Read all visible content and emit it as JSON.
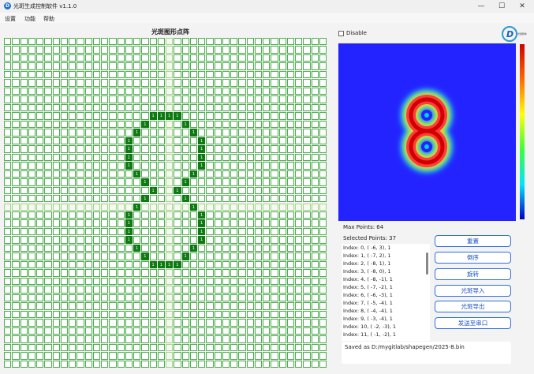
{
  "window": {
    "title": "光斑生成控制软件 v1.1.0",
    "minimize_glyph": "—",
    "maximize_glyph": "☐",
    "close_glyph": "✕"
  },
  "menu": [
    "设置",
    "功能",
    "帮助"
  ],
  "grid": {
    "title": "光斑图形点阵",
    "rows": 40,
    "cols": 40,
    "on_label": "1",
    "on_cells": [
      [
        9,
        18
      ],
      [
        9,
        19
      ],
      [
        9,
        20
      ],
      [
        9,
        21
      ],
      [
        10,
        17
      ],
      [
        10,
        22
      ],
      [
        11,
        16
      ],
      [
        11,
        23
      ],
      [
        12,
        15
      ],
      [
        12,
        24
      ],
      [
        13,
        15
      ],
      [
        13,
        24
      ],
      [
        14,
        15
      ],
      [
        14,
        24
      ],
      [
        15,
        15
      ],
      [
        15,
        24
      ],
      [
        16,
        16
      ],
      [
        16,
        23
      ],
      [
        17,
        17
      ],
      [
        17,
        22
      ],
      [
        18,
        18
      ],
      [
        18,
        21
      ],
      [
        19,
        17
      ],
      [
        19,
        22
      ],
      [
        20,
        16
      ],
      [
        20,
        23
      ],
      [
        21,
        15
      ],
      [
        21,
        24
      ],
      [
        22,
        15
      ],
      [
        22,
        24
      ],
      [
        23,
        15
      ],
      [
        23,
        24
      ],
      [
        24,
        15
      ],
      [
        24,
        24
      ],
      [
        25,
        16
      ],
      [
        25,
        23
      ],
      [
        26,
        17
      ],
      [
        26,
        22
      ],
      [
        27,
        18
      ],
      [
        27,
        19
      ],
      [
        27,
        20
      ],
      [
        27,
        21
      ]
    ]
  },
  "disable": {
    "label": "Disable",
    "checked": false
  },
  "logo": {
    "text": "光斑软件"
  },
  "heatmap": {
    "colors": {
      "background": "#2323ff",
      "hot": "#d00000",
      "ring": "#ff3b3b"
    }
  },
  "info": {
    "max_points": "Max Points: 64",
    "selected_points": "Selected Points: 37"
  },
  "points": [
    "Index: 0, ( -6,   3), 1",
    "Index: 1, ( -7,   2), 1",
    "Index: 2, ( -8,   1), 1",
    "Index: 3, ( -8,   0), 1",
    "Index: 4, ( -8,  -1), 1",
    "Index: 5, ( -7,  -2), 1",
    "Index: 6, ( -6,  -3), 1",
    "Index: 7, ( -5,  -4), 1",
    "Index: 8, ( -4,  -4), 1",
    "Index: 9, ( -3,  -4), 1",
    "Index: 10, ( -2,  -3), 1",
    "Index: 11, ( -1,  -2), 1"
  ],
  "buttons": [
    "重置",
    "倒序",
    "旋转",
    "光斑导入",
    "光斑导出",
    "发送至串口"
  ],
  "status": "Saved as D:/mygitlab/shapegen/2025-8.bin"
}
